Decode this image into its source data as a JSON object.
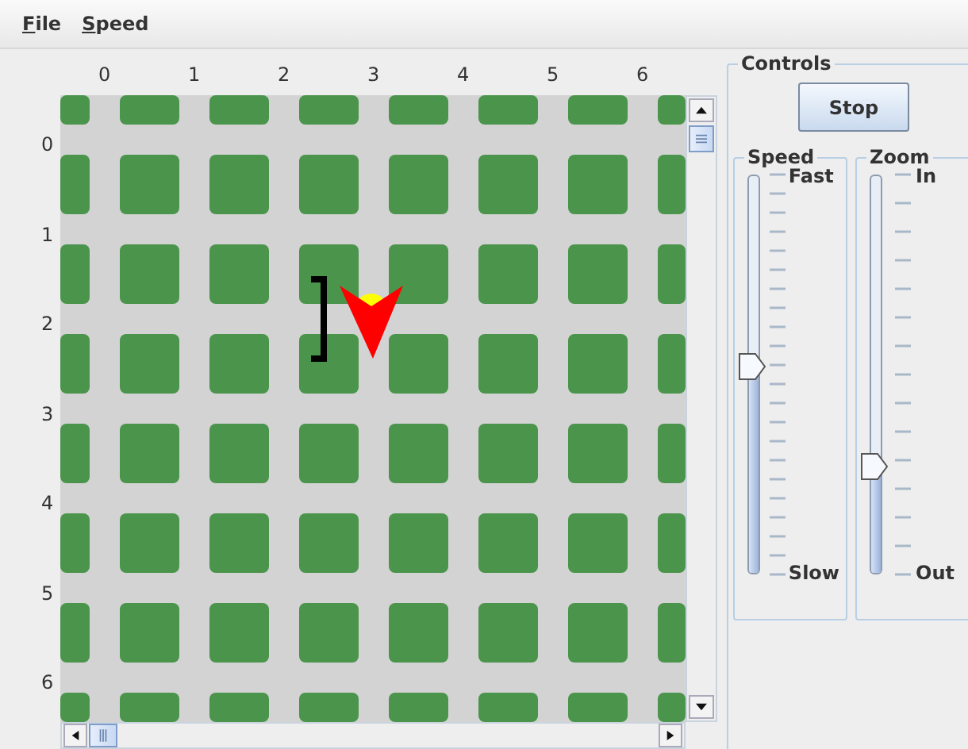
{
  "menu": [
    {
      "label": "File"
    },
    {
      "label": "Speed"
    }
  ],
  "map": {
    "column_labels": [
      "0",
      "1",
      "2",
      "3",
      "4",
      "5",
      "6"
    ],
    "row_labels": [
      "0",
      "1",
      "2",
      "3",
      "4",
      "5",
      "6"
    ]
  },
  "controls": {
    "title": "Controls",
    "button": "Stop",
    "sliders": [
      {
        "title": "Speed",
        "max_label": "Fast",
        "min_label": "Slow",
        "level": 0.52
      },
      {
        "title": "Zoom",
        "max_label": "In",
        "min_label": "Out",
        "level": 0.27
      }
    ]
  }
}
